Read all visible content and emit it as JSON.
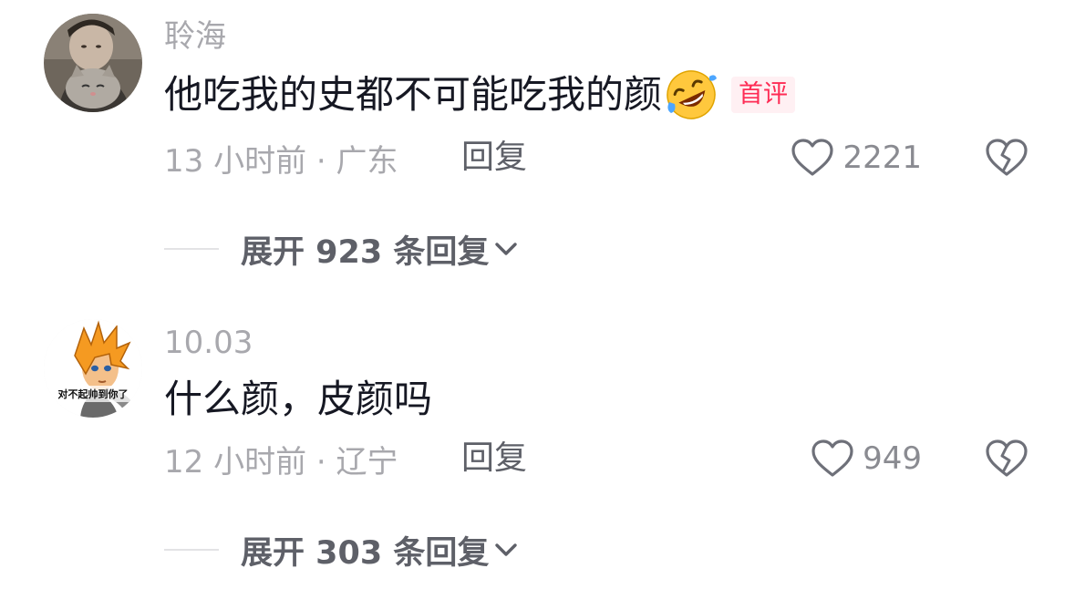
{
  "comments": [
    {
      "username": "聆海",
      "text": "他吃我的史都不可能吃我的颜",
      "emoji": "rolling-on-floor-laughing-emoji",
      "badge": "首评",
      "time_location": "13 小时前 · 广东",
      "reply_label": "回复",
      "likes": "2221",
      "expand_label": "展开 923 条回复"
    },
    {
      "username": "10.03",
      "text": "什么颜，皮颜吗",
      "time_location": "12 小时前 · 辽宁",
      "reply_label": "回复",
      "likes": "949",
      "expand_label": "展开 303 条回复",
      "avatar_caption": "对不起帅到你了"
    }
  ],
  "colors": {
    "text_primary": "#161823",
    "text_secondary": "#a8a8ad",
    "action_text": "#5e6068",
    "badge_text": "#fe2c55",
    "badge_bg": "#fff0f3"
  }
}
